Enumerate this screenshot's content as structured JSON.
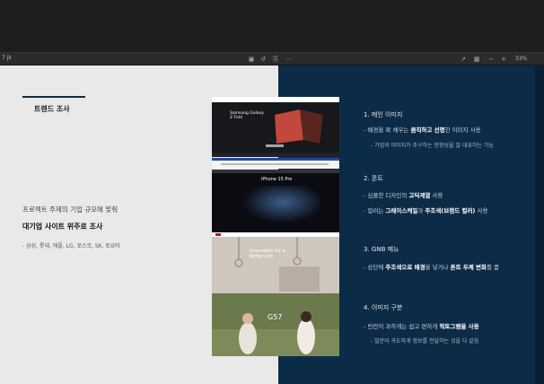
{
  "toolbar": {
    "file_name": "7 jk",
    "zoom": "33%"
  },
  "left": {
    "section_title": "트렌드 조사",
    "intro_line1": "프로젝트 주제의 기업 규모에 맞춰",
    "intro_line2": "대기업 사이트 위주로 조사",
    "intro_line3": "- 삼성, 롯데, 애플, LG, 포스코, SK, 토요타"
  },
  "shots": {
    "shot1_title": "Samsung Galaxy Z Fold",
    "shot3_title": "iPhone 15 Pro",
    "shot4_title": "Innovation for a Better Life",
    "shot5_title": "G57"
  },
  "right": {
    "categories": [
      {
        "title": "1. 메인 이미지",
        "desc_a": "- 배경을 꽉 채우는 ",
        "desc_b": "큼직하고 선명",
        "desc_c": "한 이미지 사용",
        "sub": "- 기업의 이미지가 추구하는 방향성을 잘 대표하는 기능"
      },
      {
        "title": "2. 폰트",
        "desc_a": "- 심플한 디자인의 ",
        "desc_b": "고딕계열",
        "desc_c": " 사용",
        "line2_a": "- 컬러는 ",
        "line2_b": "그레이스케일",
        "line2_c": "과 ",
        "line2_d": "주조색(브랜드 컬러)",
        "line2_e": " 사용"
      },
      {
        "title": "3. GNB 메뉴",
        "desc_a": "- 상단에 ",
        "desc_b": "주조색으로 배경",
        "desc_c": "을 넣거나 ",
        "desc_d": "폰트 두께 변화",
        "desc_e": "를 줌"
      },
      {
        "title": "4. 이미지 구분",
        "desc_a": "- 빈칸이 과하게는 쉽고 편하게 ",
        "desc_b": "픽토그램을 사용",
        "sub": "- 빌문이 과도하게 정보를 전달하는 것을 다 같음"
      }
    ]
  }
}
